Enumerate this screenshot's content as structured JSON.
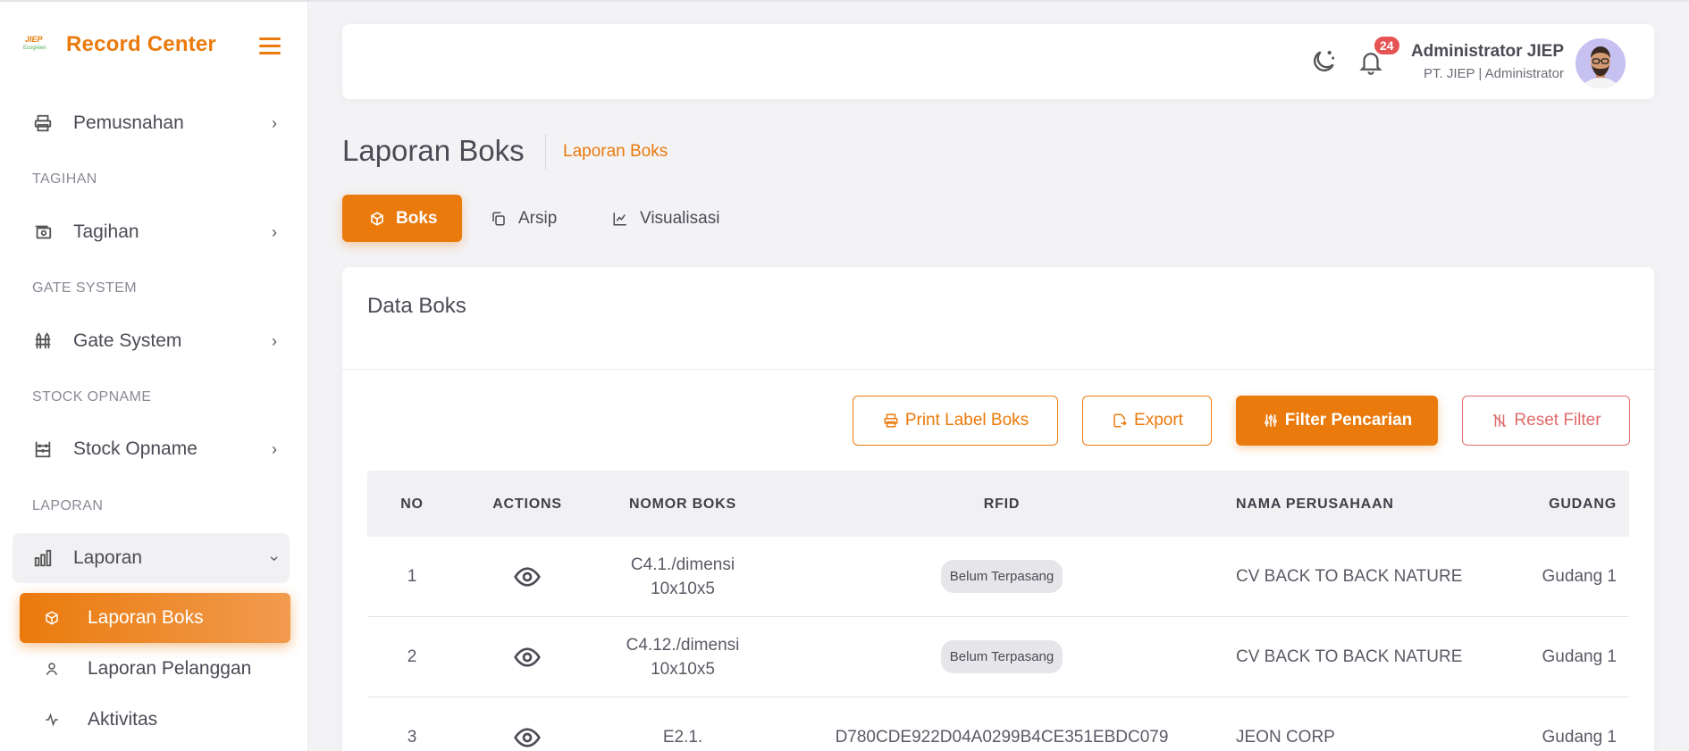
{
  "brand": {
    "logo_text_top": "JIEP",
    "logo_text_bottom": "Ecogreen",
    "name": "Record Center"
  },
  "sidebar": {
    "items": [
      {
        "type": "item",
        "label": "Pemusnahan",
        "icon": "printer-icon"
      },
      {
        "type": "section",
        "label": "TAGIHAN"
      },
      {
        "type": "item",
        "label": "Tagihan",
        "icon": "cash-icon"
      },
      {
        "type": "section",
        "label": "GATE SYSTEM"
      },
      {
        "type": "item",
        "label": "Gate System",
        "icon": "fence-icon"
      },
      {
        "type": "section",
        "label": "STOCK OPNAME"
      },
      {
        "type": "item",
        "label": "Stock Opname",
        "icon": "abacus-icon"
      },
      {
        "type": "section",
        "label": "LAPORAN"
      },
      {
        "type": "item",
        "label": "Laporan",
        "icon": "chart-bar-icon",
        "open": true
      }
    ],
    "sub_items": [
      {
        "label": "Laporan Boks",
        "icon": "box-icon",
        "active": true
      },
      {
        "label": "Laporan Pelanggan",
        "icon": "user-icon"
      },
      {
        "label": "Aktivitas",
        "icon": "activity-icon"
      }
    ]
  },
  "topbar": {
    "notification_count": "24",
    "user_name": "Administrator JIEP",
    "user_role": "PT. JIEP | Administrator"
  },
  "page": {
    "title": "Laporan Boks",
    "breadcrumb": "Laporan Boks",
    "tabs": [
      {
        "label": "Boks",
        "icon": "box-icon",
        "active": true
      },
      {
        "label": "Arsip",
        "icon": "copy-icon"
      },
      {
        "label": "Visualisasi",
        "icon": "chart-line-icon"
      }
    ]
  },
  "card": {
    "title": "Data Boks",
    "buttons": {
      "print": "Print Label Boks",
      "export": "Export",
      "filter": "Filter Pencarian",
      "reset": "Reset Filter"
    }
  },
  "table": {
    "headers": [
      "NO",
      "ACTIONS",
      "NOMOR BOKS",
      "RFID",
      "NAMA PERUSAHAAN",
      "GUDANG"
    ],
    "rows": [
      {
        "no": "1",
        "nomor_boks": "C4.1./dimensi 10x10x5",
        "rfid": "Belum Terpasang",
        "rfid_badge": true,
        "nama": "CV BACK TO BACK NATURE",
        "gudang": "Gudang 1"
      },
      {
        "no": "2",
        "nomor_boks": "C4.12./dimensi 10x10x5",
        "rfid": "Belum Terpasang",
        "rfid_badge": true,
        "nama": "CV BACK TO BACK NATURE",
        "gudang": "Gudang 1"
      },
      {
        "no": "3",
        "nomor_boks": "E2.1.",
        "rfid": "D780CDE922D04A0299B4CE351EBDC079",
        "rfid_badge": false,
        "nama": "JEON CORP",
        "gudang": "Gudang 1"
      }
    ]
  },
  "colors": {
    "accent": "#ea7a0c",
    "danger": "#e55353",
    "background": "#f3f3f6"
  }
}
